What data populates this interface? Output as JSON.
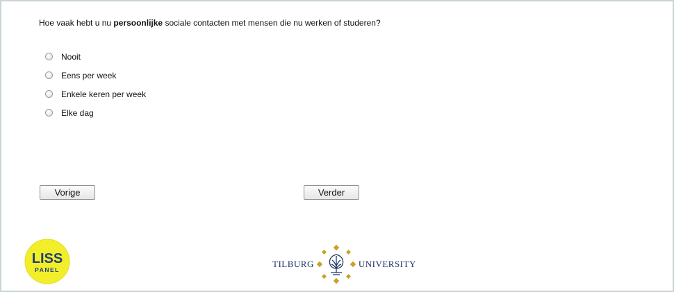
{
  "question": {
    "prefix": "Hoe vaak hebt u nu ",
    "emphasis": "persoonlijke",
    "suffix": " sociale contacten met mensen die nu werken of studeren?"
  },
  "options": [
    {
      "label": "Nooit"
    },
    {
      "label": "Eens per week"
    },
    {
      "label": "Enkele keren per week"
    },
    {
      "label": "Elke dag"
    }
  ],
  "buttons": {
    "prev_label": "Vorige",
    "next_label": "Verder"
  },
  "footer": {
    "liss_logo": {
      "line1": "LISS",
      "line2": "PANEL"
    },
    "tilburg_logo": {
      "left": "TILBURG",
      "right": "UNIVERSITY"
    }
  },
  "colors": {
    "frame_border": "#c9d3d8",
    "liss_yellow": "#f2ee2a",
    "liss_text": "#1f3f7a",
    "tilburg_blue": "#1f3566",
    "tilburg_gold": "#c9a227"
  }
}
